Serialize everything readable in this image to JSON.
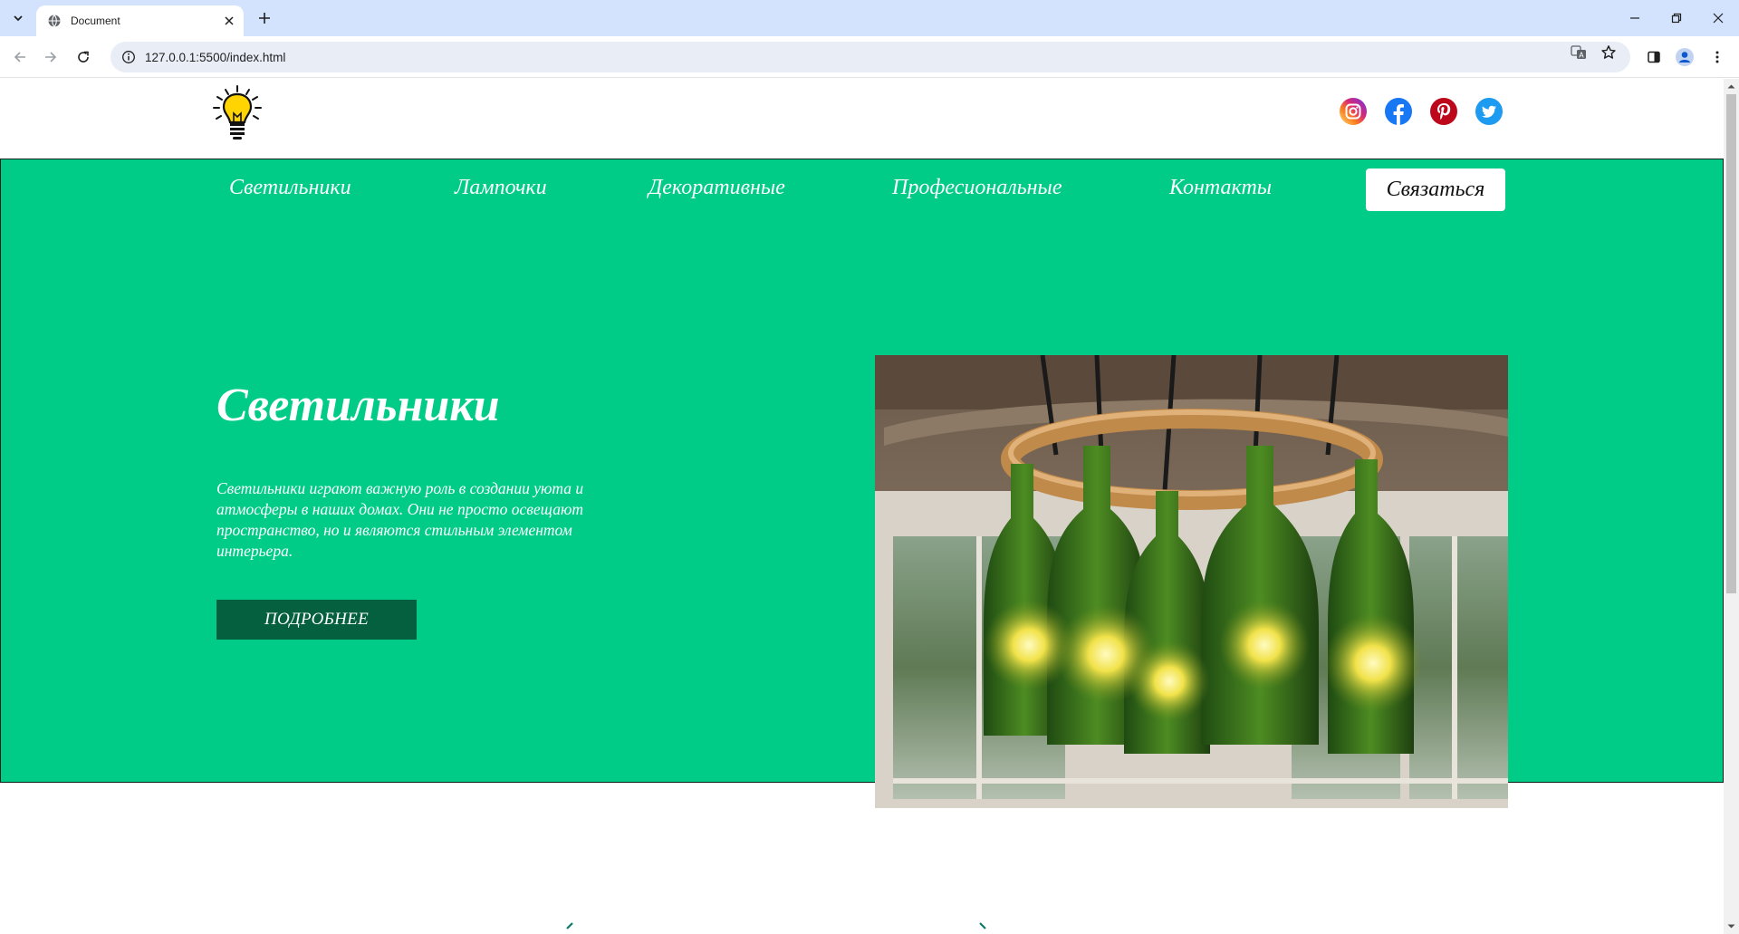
{
  "browser": {
    "tab_title": "Document",
    "url": "127.0.0.1:5500/index.html"
  },
  "icons": {
    "tab_search": "chevron-down-icon",
    "favicon": "globe-icon",
    "tab_close": "close-icon",
    "new_tab": "plus-icon",
    "minimize": "minimize-icon",
    "restore": "restore-icon",
    "close_window": "close-icon",
    "back": "arrow-left-icon",
    "forward": "arrow-right-icon",
    "reload": "reload-icon",
    "site_info": "info-icon",
    "translate": "translate-icon",
    "bookmark": "star-icon",
    "side_panel": "side-panel-icon",
    "profile": "profile-icon",
    "menu": "kebab-menu-icon",
    "logo": "lightbulb-icon",
    "instagram": "instagram-icon",
    "facebook": "facebook-icon",
    "pinterest": "pinterest-icon",
    "twitter": "twitter-icon"
  },
  "header": {
    "socials": [
      "Instagram",
      "Facebook",
      "Pinterest",
      "Twitter"
    ]
  },
  "nav": {
    "items": [
      "Светильники",
      "Лампочки",
      "Декоративные",
      "Професиональные",
      "Контакты"
    ],
    "contact_button": "Связаться"
  },
  "hero": {
    "title": "Светильники",
    "text": "Светильники играют важную роль в создании уюта и атмосферы в наших домах. Они не просто освещают пространство, но и являются стильным элементом интерьера.",
    "button": "ПОДРОБНЕЕ",
    "image_alt": "bottle-chandelier-image"
  },
  "colors": {
    "hero_bg": "#00cc87",
    "button_bg": "#05603f",
    "tabstrip_bg": "#d3e3fd"
  }
}
